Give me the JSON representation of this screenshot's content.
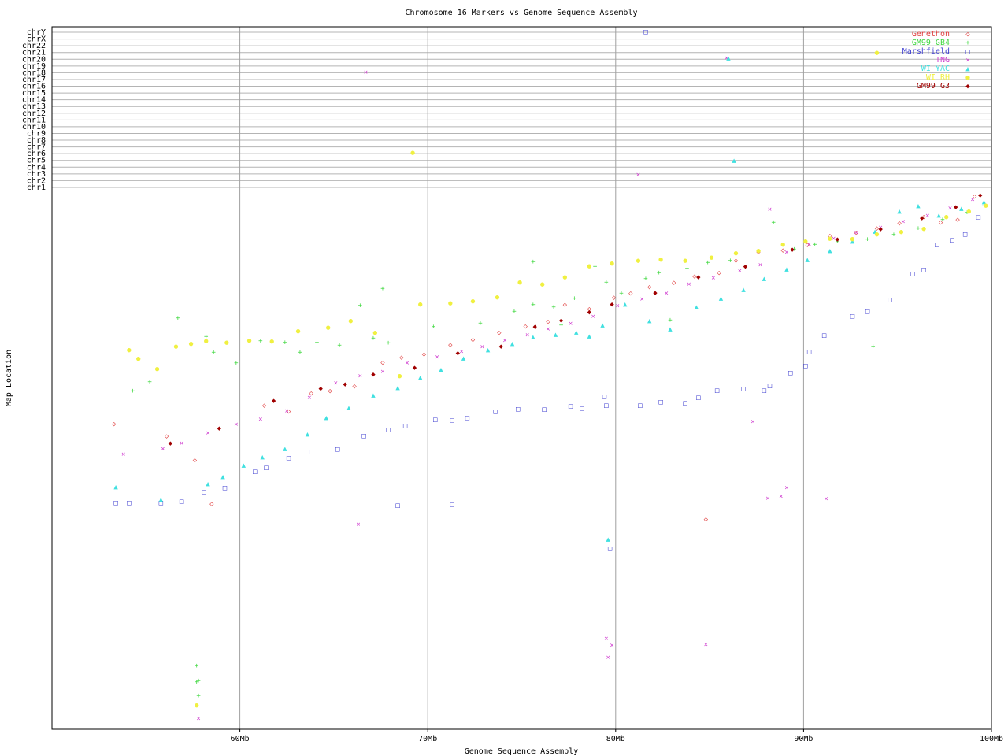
{
  "chart_data": {
    "type": "scatter",
    "title": "Chromosome 16 Markers vs Genome Sequence Assembly",
    "xlabel": "Genome Sequence Assembly",
    "ylabel": "Map Location",
    "xlim": [
      50,
      100
    ],
    "x_ticks": [
      {
        "value": 60,
        "label": "60Mb"
      },
      {
        "value": 70,
        "label": "70Mb"
      },
      {
        "value": 80,
        "label": "80Mb"
      },
      {
        "value": 90,
        "label": "90Mb"
      },
      {
        "value": 100,
        "label": "100Mb"
      }
    ],
    "chromosome_lanes": [
      "chr1",
      "chr2",
      "chr3",
      "chr4",
      "chr5",
      "chr6",
      "chr7",
      "chr8",
      "chr9",
      "chr10",
      "chr11",
      "chr12",
      "chr13",
      "chr14",
      "chr15",
      "chr16",
      "chr17",
      "chr18",
      "chr19",
      "chr20",
      "chr21",
      "chr22",
      "chrX",
      "chrY"
    ],
    "map_ylim": [
      0,
      100
    ],
    "grid": true,
    "legend_position": "top-right",
    "series": [
      {
        "name": "Genethon",
        "color": "#e04040",
        "glyph": "◇",
        "points": [
          [
            53.3,
            43.5
          ],
          [
            56.1,
            45.8
          ],
          [
            57.6,
            50.2
          ],
          [
            58.5,
            58.3
          ],
          [
            61.3,
            40.1
          ],
          [
            62.6,
            41.2
          ],
          [
            63.8,
            37.8
          ],
          [
            64.8,
            37.4
          ],
          [
            66.1,
            36.5
          ],
          [
            67.6,
            32.1
          ],
          [
            68.6,
            31.2
          ],
          [
            69.8,
            30.6
          ],
          [
            71.2,
            28.8
          ],
          [
            72.4,
            27.9
          ],
          [
            73.8,
            26.6
          ],
          [
            75.2,
            25.4
          ],
          [
            76.4,
            24.5
          ],
          [
            77.3,
            21.4
          ],
          [
            78.6,
            22.2
          ],
          [
            79.9,
            20.1
          ],
          [
            80.8,
            19.3
          ],
          [
            81.8,
            18.1
          ],
          [
            83.1,
            17.3
          ],
          [
            84.2,
            16.1
          ],
          [
            85.5,
            15.5
          ],
          [
            86.4,
            13.2
          ],
          [
            87.6,
            11.6
          ],
          [
            88.9,
            11.3
          ],
          [
            90.2,
            10.3
          ],
          [
            91.4,
            8.6
          ],
          [
            92.8,
            8.0
          ],
          [
            93.9,
            7.2
          ],
          [
            95.1,
            6.3
          ],
          [
            96.4,
            5.1
          ],
          [
            97.3,
            6.1
          ],
          [
            98.2,
            5.6
          ],
          [
            99.1,
            1.3
          ],
          [
            84.8,
            61.2
          ]
        ]
      },
      {
        "name": "GM99 GB4",
        "color": "#40d840",
        "glyph": "+",
        "points": [
          [
            54.3,
            37.4
          ],
          [
            55.2,
            35.7
          ],
          [
            56.7,
            23.9
          ],
          [
            58.2,
            27.3
          ],
          [
            58.6,
            30.2
          ],
          [
            59.8,
            32.2
          ],
          [
            61.1,
            28.1
          ],
          [
            62.4,
            28.4
          ],
          [
            63.2,
            30.2
          ],
          [
            64.1,
            28.4
          ],
          [
            65.3,
            28.9
          ],
          [
            66.4,
            21.5
          ],
          [
            67.1,
            27.6
          ],
          [
            67.9,
            28.5
          ],
          [
            70.3,
            25.5
          ],
          [
            72.8,
            24.8
          ],
          [
            74.6,
            22.6
          ],
          [
            75.6,
            21.4
          ],
          [
            76.7,
            21.8
          ],
          [
            77.8,
            20.2
          ],
          [
            78.9,
            14.3
          ],
          [
            79.5,
            17.2
          ],
          [
            80.3,
            19.3
          ],
          [
            81.6,
            16.6
          ],
          [
            82.3,
            15.5
          ],
          [
            83.8,
            14.7
          ],
          [
            84.9,
            13.6
          ],
          [
            86.1,
            13.2
          ],
          [
            88.4,
            6.1
          ],
          [
            89.5,
            11.1
          ],
          [
            90.6,
            10.2
          ],
          [
            91.8,
            9.7
          ],
          [
            92.6,
            9.3
          ],
          [
            93.4,
            9.3
          ],
          [
            94.8,
            8.4
          ],
          [
            96.1,
            7.2
          ],
          [
            97.4,
            5.6
          ],
          [
            98.7,
            4.3
          ],
          [
            99.6,
            3.1
          ],
          [
            57.7,
            88.3
          ],
          [
            57.8,
            91.1
          ],
          [
            57.7,
            91.3
          ],
          [
            57.8,
            93.9
          ],
          [
            93.7,
            29.1
          ],
          [
            75.6,
            13.4
          ],
          [
            67.6,
            18.4
          ],
          [
            77.1,
            25.2
          ],
          [
            82.9,
            24.2
          ]
        ]
      },
      {
        "name": "Marshfield",
        "color": "#4040d0",
        "glyph": "□",
        "points": [
          [
            53.4,
            58.1
          ],
          [
            54.1,
            58.1
          ],
          [
            55.8,
            58.1
          ],
          [
            56.9,
            57.9
          ],
          [
            58.1,
            56.1
          ],
          [
            59.2,
            55.3
          ],
          [
            60.8,
            52.3
          ],
          [
            61.4,
            51.6
          ],
          [
            62.6,
            49.8
          ],
          [
            63.8,
            48.6
          ],
          [
            65.2,
            48.2
          ],
          [
            66.6,
            45.7
          ],
          [
            67.9,
            44.5
          ],
          [
            68.8,
            43.8
          ],
          [
            70.4,
            42.7
          ],
          [
            71.3,
            42.8
          ],
          [
            72.1,
            42.3
          ],
          [
            73.6,
            41.2
          ],
          [
            74.8,
            40.7
          ],
          [
            76.2,
            40.8
          ],
          [
            77.6,
            40.2
          ],
          [
            78.2,
            40.6
          ],
          [
            79.4,
            38.4
          ],
          [
            79.5,
            40.1
          ],
          [
            81.3,
            40.1
          ],
          [
            82.4,
            39.4
          ],
          [
            83.7,
            39.6
          ],
          [
            84.4,
            38.6
          ],
          [
            85.4,
            37.3
          ],
          [
            86.8,
            37.0
          ],
          [
            87.9,
            37.3
          ],
          [
            88.2,
            36.4
          ],
          [
            89.3,
            34.0
          ],
          [
            90.1,
            32.7
          ],
          [
            90.3,
            30.1
          ],
          [
            91.1,
            27.1
          ],
          [
            92.6,
            23.5
          ],
          [
            93.4,
            22.6
          ],
          [
            94.6,
            20.5
          ],
          [
            95.8,
            15.7
          ],
          [
            96.4,
            14.9
          ],
          [
            97.1,
            10.3
          ],
          [
            97.9,
            9.4
          ],
          [
            98.6,
            8.3
          ],
          [
            99.3,
            5.2
          ],
          [
            68.4,
            58.6
          ],
          [
            71.3,
            58.5
          ],
          [
            79.7,
            66.6
          ],
          [
            81.6,
            -23.1
          ]
        ]
      },
      {
        "name": "TNG",
        "color": "#d040d0",
        "glyph": "×",
        "points": [
          [
            53.8,
            49.1
          ],
          [
            55.9,
            48.1
          ],
          [
            56.9,
            47.1
          ],
          [
            58.3,
            45.2
          ],
          [
            59.8,
            43.6
          ],
          [
            61.1,
            42.6
          ],
          [
            62.5,
            41.1
          ],
          [
            63.7,
            38.6
          ],
          [
            65.1,
            35.9
          ],
          [
            66.4,
            34.6
          ],
          [
            67.6,
            33.8
          ],
          [
            68.9,
            32.2
          ],
          [
            70.5,
            31.1
          ],
          [
            71.8,
            30.1
          ],
          [
            72.9,
            29.2
          ],
          [
            74.1,
            28.0
          ],
          [
            75.3,
            27.0
          ],
          [
            76.4,
            25.9
          ],
          [
            77.6,
            24.9
          ],
          [
            78.8,
            23.6
          ],
          [
            80.1,
            21.6
          ],
          [
            81.4,
            20.4
          ],
          [
            82.7,
            19.3
          ],
          [
            83.9,
            17.6
          ],
          [
            85.2,
            16.4
          ],
          [
            86.6,
            15.1
          ],
          [
            87.7,
            14.0
          ],
          [
            89.1,
            11.7
          ],
          [
            90.3,
            10.2
          ],
          [
            91.6,
            9.1
          ],
          [
            92.8,
            8.0
          ],
          [
            94.1,
            7.1
          ],
          [
            95.3,
            6.0
          ],
          [
            96.6,
            4.9
          ],
          [
            97.8,
            3.5
          ],
          [
            99.0,
            1.9
          ],
          [
            87.3,
            43.1
          ],
          [
            88.1,
            57.3
          ],
          [
            88.8,
            56.9
          ],
          [
            89.1,
            55.3
          ],
          [
            91.2,
            57.4
          ],
          [
            66.3,
            62.1
          ],
          [
            79.8,
            84.5
          ],
          [
            79.5,
            83.3
          ],
          [
            79.6,
            86.8
          ],
          [
            84.8,
            84.4
          ],
          [
            57.8,
            98.1
          ],
          [
            88.2,
            3.7
          ],
          [
            66.7,
            -17.1
          ],
          [
            81.2,
            -1.9
          ],
          [
            85.9,
            -19.2
          ]
        ]
      },
      {
        "name": "WI YAC",
        "color": "#40e0e0",
        "glyph": "▲",
        "points": [
          [
            53.4,
            55.2
          ],
          [
            55.8,
            57.5
          ],
          [
            58.3,
            54.6
          ],
          [
            59.1,
            53.3
          ],
          [
            60.2,
            51.2
          ],
          [
            61.2,
            49.6
          ],
          [
            62.4,
            48.1
          ],
          [
            63.6,
            45.4
          ],
          [
            64.6,
            42.3
          ],
          [
            65.8,
            40.5
          ],
          [
            67.1,
            38.2
          ],
          [
            68.4,
            36.8
          ],
          [
            69.6,
            34.9
          ],
          [
            70.7,
            33.4
          ],
          [
            71.9,
            31.3
          ],
          [
            73.2,
            29.8
          ],
          [
            74.5,
            28.6
          ],
          [
            75.6,
            27.4
          ],
          [
            76.8,
            26.9
          ],
          [
            77.9,
            26.5
          ],
          [
            78.6,
            27.2
          ],
          [
            79.3,
            25.2
          ],
          [
            80.5,
            21.3
          ],
          [
            81.8,
            24.4
          ],
          [
            82.9,
            25.9
          ],
          [
            84.3,
            21.8
          ],
          [
            85.6,
            20.2
          ],
          [
            86.8,
            18.6
          ],
          [
            87.9,
            16.6
          ],
          [
            89.1,
            14.8
          ],
          [
            90.2,
            13.1
          ],
          [
            91.4,
            11.4
          ],
          [
            92.6,
            9.6
          ],
          [
            93.8,
            7.8
          ],
          [
            95.1,
            4.1
          ],
          [
            96.1,
            3.1
          ],
          [
            97.2,
            4.8
          ],
          [
            98.4,
            3.6
          ],
          [
            99.6,
            2.3
          ],
          [
            79.6,
            64.9
          ],
          [
            86.3,
            -4.0
          ],
          [
            86.0,
            -19.2
          ]
        ]
      },
      {
        "name": "WI RH",
        "color": "#f0f040",
        "glyph": "●",
        "points": [
          [
            54.1,
            29.8
          ],
          [
            54.6,
            31.4
          ],
          [
            55.6,
            33.3
          ],
          [
            56.6,
            29.1
          ],
          [
            57.4,
            28.6
          ],
          [
            58.2,
            28.1
          ],
          [
            59.3,
            28.4
          ],
          [
            60.5,
            28.0
          ],
          [
            61.7,
            28.2
          ],
          [
            63.1,
            26.3
          ],
          [
            64.7,
            25.6
          ],
          [
            65.9,
            24.4
          ],
          [
            67.2,
            26.6
          ],
          [
            68.5,
            34.6
          ],
          [
            69.6,
            21.3
          ],
          [
            71.2,
            21.1
          ],
          [
            72.4,
            20.7
          ],
          [
            73.7,
            20.0
          ],
          [
            74.9,
            17.2
          ],
          [
            76.1,
            17.6
          ],
          [
            77.3,
            16.3
          ],
          [
            78.6,
            14.2
          ],
          [
            79.8,
            13.7
          ],
          [
            81.2,
            13.2
          ],
          [
            82.4,
            13.0
          ],
          [
            83.7,
            13.2
          ],
          [
            85.1,
            12.6
          ],
          [
            86.4,
            11.8
          ],
          [
            87.6,
            11.4
          ],
          [
            88.9,
            10.2
          ],
          [
            90.1,
            9.6
          ],
          [
            91.4,
            9.1
          ],
          [
            92.6,
            9.2
          ],
          [
            93.9,
            8.3
          ],
          [
            95.2,
            7.9
          ],
          [
            96.4,
            7.3
          ],
          [
            97.6,
            5.1
          ],
          [
            98.8,
            4.1
          ],
          [
            99.7,
            3.0
          ],
          [
            57.7,
            95.6
          ],
          [
            69.2,
            -5.2
          ],
          [
            93.9,
            -20.0
          ]
        ]
      },
      {
        "name": "GM99 G3",
        "color": "#a00000",
        "glyph": "◆",
        "points": [
          [
            56.3,
            47.1
          ],
          [
            58.9,
            44.3
          ],
          [
            61.8,
            39.2
          ],
          [
            64.3,
            36.9
          ],
          [
            65.6,
            36.1
          ],
          [
            67.1,
            34.3
          ],
          [
            69.3,
            33.1
          ],
          [
            71.6,
            30.4
          ],
          [
            73.9,
            29.1
          ],
          [
            75.7,
            25.5
          ],
          [
            77.1,
            24.3
          ],
          [
            78.6,
            22.8
          ],
          [
            79.8,
            21.3
          ],
          [
            82.1,
            19.2
          ],
          [
            84.4,
            16.3
          ],
          [
            86.9,
            14.3
          ],
          [
            89.4,
            11.2
          ],
          [
            91.8,
            9.3
          ],
          [
            94.1,
            7.4
          ],
          [
            96.3,
            5.3
          ],
          [
            98.1,
            3.3
          ],
          [
            99.4,
            1.1
          ]
        ]
      }
    ]
  }
}
